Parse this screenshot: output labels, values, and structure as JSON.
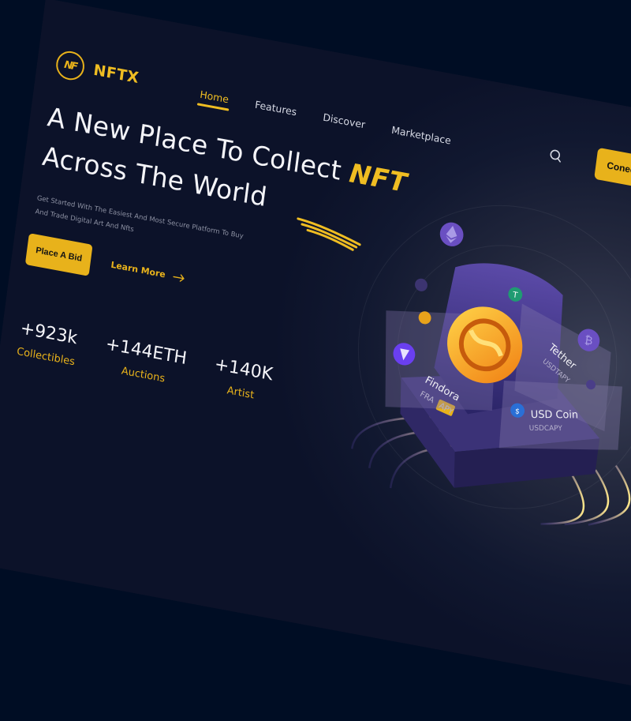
{
  "brand": {
    "name": "NFTX",
    "logo_mark": "NF"
  },
  "nav": {
    "items": [
      {
        "label": "Home",
        "active": true
      },
      {
        "label": "Features",
        "active": false
      },
      {
        "label": "Discover",
        "active": false
      },
      {
        "label": "Marketplace",
        "active": false
      }
    ]
  },
  "header": {
    "search_icon": "search-icon",
    "connect_label": "Conect To Wallet"
  },
  "hero": {
    "title_line1": "A New Place To Collect",
    "title_highlight": "NFT",
    "title_line2": "Across The World",
    "subtitle": "Get Started With The Easiest And Most Secure Platform To Buy And Trade Digital Art And Nfts",
    "primary_cta": "Place A Bid",
    "secondary_cta": "Learn More",
    "secondary_icon": "arrow-right-icon"
  },
  "stats": [
    {
      "value": "+923k",
      "label": "Collectibles"
    },
    {
      "value": "+144ETH",
      "label": "Auctions"
    },
    {
      "value": "+140K",
      "label": "Artist"
    }
  ],
  "illustration": {
    "cards": [
      {
        "title": "Findora",
        "sub1": "FRA",
        "sub2": "APY"
      },
      {
        "title": "Tether",
        "sub1": "USDTAPY"
      },
      {
        "title": "USD Coin",
        "sub1": "USDCAPY"
      }
    ],
    "coins": [
      "ethereum-icon",
      "bitcoin-icon",
      "tether-icon",
      "usdc-icon",
      "findora-icon"
    ]
  },
  "colors": {
    "accent": "#e8b21b",
    "background": "#000d24",
    "panel": "#0c1229",
    "purple": "#6a4fc2"
  }
}
